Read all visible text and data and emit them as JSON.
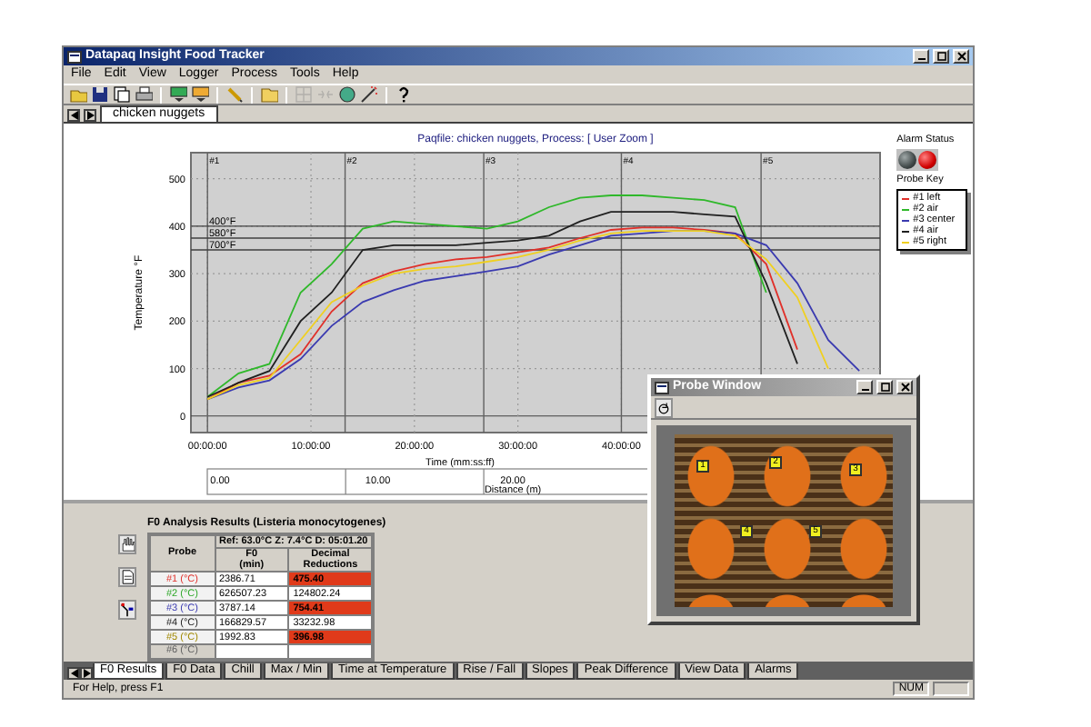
{
  "window": {
    "title": "Datapaq Insight Food Tracker"
  },
  "menu": [
    "File",
    "Edit",
    "View",
    "Logger",
    "Process",
    "Tools",
    "Help"
  ],
  "toolbar": [
    {
      "disabled": false
    },
    {
      "disabled": false
    },
    {
      "disabled": false
    },
    {
      "disabled": false
    },
    {
      "disabled": false
    },
    {
      "disabled": false
    },
    {
      "disabled": false
    },
    {
      "disabled": false
    },
    {
      "disabled": true
    },
    {
      "disabled": true
    },
    {
      "disabled": false
    },
    {
      "disabled": false
    },
    {
      "disabled": false
    }
  ],
  "document_tabs": [
    {
      "label": "chicken nuggets",
      "selected": true
    }
  ],
  "chart": {
    "chart_data": {
      "type": "line",
      "title": "Paqfile: chicken nuggets, Process: [ User Zoom ]",
      "xlabel": "Time (mm:ss:ff)",
      "ylabel": "Temperature °F",
      "grid": true,
      "x": [
        0,
        3,
        6,
        9,
        12,
        15,
        18,
        21,
        24,
        27,
        30,
        33,
        36,
        39,
        42,
        45,
        48,
        51,
        54,
        57,
        60,
        63
      ],
      "series": [
        {
          "name": "#1 left",
          "color": "#e0302a",
          "values": [
            35,
            70,
            85,
            130,
            220,
            280,
            305,
            320,
            330,
            335,
            345,
            355,
            375,
            392,
            397,
            397,
            392,
            385,
            320,
            140,
            null,
            null
          ]
        },
        {
          "name": "#2 air",
          "color": "#2fb82a",
          "values": [
            40,
            90,
            110,
            260,
            320,
            395,
            410,
            405,
            400,
            395,
            410,
            440,
            460,
            465,
            465,
            460,
            455,
            440,
            260,
            null,
            null,
            null
          ]
        },
        {
          "name": "#3 center",
          "color": "#3a3ab0",
          "values": [
            35,
            60,
            75,
            120,
            190,
            240,
            265,
            285,
            295,
            305,
            315,
            340,
            360,
            380,
            385,
            390,
            390,
            385,
            360,
            280,
            160,
            95
          ]
        },
        {
          "name": "#4 air",
          "color": "#202020",
          "values": [
            40,
            70,
            95,
            200,
            260,
            350,
            360,
            360,
            360,
            365,
            370,
            380,
            410,
            430,
            430,
            430,
            425,
            420,
            280,
            110,
            null,
            null
          ]
        },
        {
          "name": "#5 right",
          "color": "#f0d020",
          "values": [
            35,
            65,
            80,
            160,
            240,
            275,
            300,
            310,
            315,
            325,
            335,
            350,
            370,
            385,
            390,
            390,
            390,
            380,
            330,
            250,
            100,
            null
          ]
        }
      ],
      "xlim": [
        -1.6,
        65
      ],
      "ylim": [
        -35,
        555
      ],
      "xticks": [
        {
          "value": 0,
          "label": "00:00:00"
        },
        {
          "value": 10,
          "label": "10:00:00"
        },
        {
          "value": 20,
          "label": "20:00:00"
        },
        {
          "value": 30,
          "label": "30:00:00"
        },
        {
          "value": 40,
          "label": "40:00:00"
        }
      ],
      "yticks": [
        0,
        100,
        200,
        300,
        400,
        500
      ]
    },
    "event_markers": [
      "#1",
      "#2",
      "#3",
      "#4",
      "#5"
    ],
    "reference_lines": [
      "400°F",
      "580°F",
      "700°F"
    ],
    "distance_axis": {
      "label": "Distance (m)",
      "ticks": [
        "0.00",
        "10.00",
        "20.00"
      ]
    }
  },
  "alarm_status": {
    "label": "Alarm Status",
    "lights": [
      {
        "on": false
      },
      {
        "on": true
      }
    ]
  },
  "probe_key": {
    "label": "Probe Key"
  },
  "f0_results": {
    "title": "F0 Analysis Results (Listeria monocytogenes)",
    "reference": "Ref: 63.0°C Z: 7.4°C D: 05:01.20",
    "columns": [
      "Probe",
      "F0\n(min)",
      "Decimal\nReductions"
    ],
    "rows": [
      {
        "probe": "#1 (°C)",
        "color": "#e0302a",
        "f0": "2386.71",
        "reductions": "475.40",
        "alert": true,
        "disabled": false
      },
      {
        "probe": "#2 (°C)",
        "color": "#2fa82a",
        "f0": "626507.23",
        "reductions": "124802.24",
        "alert": false,
        "disabled": false
      },
      {
        "probe": "#3 (°C)",
        "color": "#3a3ab0",
        "f0": "3787.14",
        "reductions": "754.41",
        "alert": true,
        "disabled": false
      },
      {
        "probe": "#4 (°C)",
        "color": "#202020",
        "f0": "166829.57",
        "reductions": "33232.98",
        "alert": false,
        "disabled": false
      },
      {
        "probe": "#5 (°C)",
        "color": "#a08800",
        "f0": "1992.83",
        "reductions": "396.98",
        "alert": true,
        "disabled": false
      },
      {
        "probe": "#6 (°C)",
        "color": "#606060",
        "f0": "",
        "reductions": "",
        "alert": false,
        "disabled": true
      }
    ]
  },
  "probe_window": {
    "title": "Probe Window",
    "markers": [
      "1",
      "2",
      "3",
      "4",
      "5"
    ]
  },
  "bottom_tabs": [
    {
      "label": "F0 Results",
      "selected": true
    },
    {
      "label": "F0 Data",
      "selected": false
    },
    {
      "label": "Chill",
      "selected": false
    },
    {
      "label": "Max / Min",
      "selected": false
    },
    {
      "label": "Time at Temperature",
      "selected": false
    },
    {
      "label": "Rise / Fall",
      "selected": false
    },
    {
      "label": "Slopes",
      "selected": false
    },
    {
      "label": "Peak Difference",
      "selected": false
    },
    {
      "label": "View Data",
      "selected": false
    },
    {
      "label": "Alarms",
      "selected": false
    }
  ],
  "status_bar": {
    "message": "For Help, press F1",
    "indicator": "NUM"
  }
}
